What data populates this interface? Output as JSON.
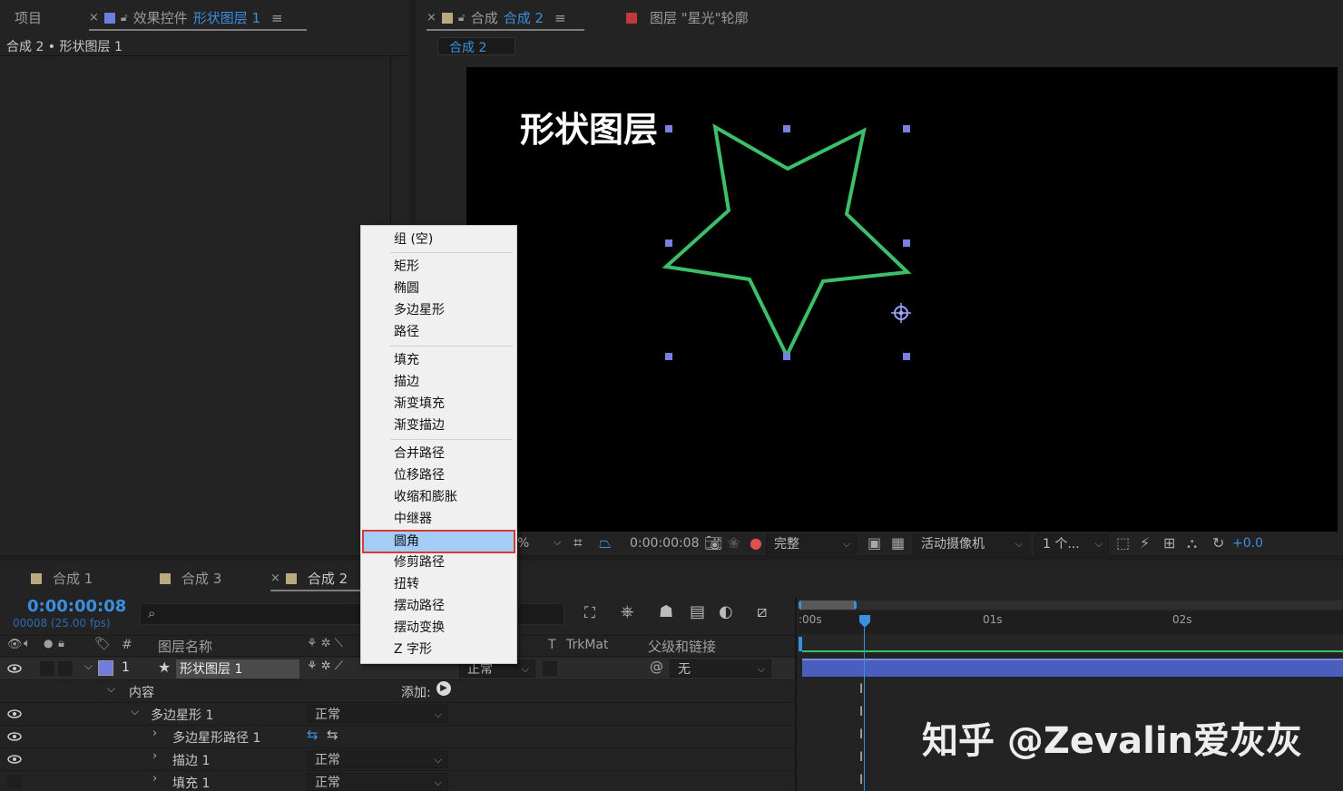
{
  "top_tabs": {
    "project": "项目",
    "effects_label": "效果控件",
    "effects_layer": "形状图层 1",
    "comp_label": "合成",
    "comp_name": "合成 2",
    "layer_panel": "图层 \"星光\"轮廓",
    "close_glyph": "×",
    "menu_glyph": "≡"
  },
  "effects_panel": {
    "breadcrumb": "合成 2 • 形状图层 1"
  },
  "viewer": {
    "comp_tab": "合成 2",
    "canvas_text": "形状图层",
    "toolbar": {
      "zoom_fragment": "%",
      "timecode": "0:00:00:08",
      "resolution": "完整",
      "camera": "活动摄像机",
      "views": "1 个...",
      "exposure": "+0.0"
    }
  },
  "context_menu": {
    "groups": [
      [
        "组 (空)"
      ],
      [
        "矩形",
        "椭圆",
        "多边星形",
        "路径"
      ],
      [
        "填充",
        "描边",
        "渐变填充",
        "渐变描边"
      ],
      [
        "合并路径",
        "位移路径",
        "收缩和膨胀",
        "中继器",
        "圆角",
        "修剪路径",
        "扭转",
        "摆动路径",
        "摆动变换",
        "Z 字形"
      ]
    ],
    "highlighted": "圆角"
  },
  "timeline": {
    "tabs": [
      "合成 1",
      "合成 3",
      "合成 2"
    ],
    "current_time": "0:00:00:08",
    "frame_info": "00008 (25.00 fps)",
    "headers": {
      "num": "#",
      "layer_name": "图层名称",
      "trkmat": "TrkMat",
      "trkmat_t": "T",
      "parent": "父级和链接"
    },
    "ruler": [
      ":00s",
      "01s",
      "02s"
    ],
    "layer": {
      "num": "1",
      "name": "形状图层 1",
      "mode": "正常",
      "parent": "无"
    },
    "contents": {
      "label": "内容",
      "add_label": "添加:"
    },
    "rows": [
      {
        "name": "多边星形 1",
        "mode": "正常"
      },
      {
        "name": "多边星形路径 1"
      },
      {
        "name": "描边 1",
        "mode": "正常"
      },
      {
        "name": "填充 1",
        "mode": "正常"
      }
    ]
  },
  "watermark": "知乎 @Zevalin爱灰灰",
  "colors": {
    "accent_blue": "#3c8fe0",
    "star_stroke": "#3dbf6a",
    "handle": "#7b7fe0",
    "layer_bar": "#4a5fbd",
    "menu_highlight": "#a3cdf7",
    "menu_outline": "#d63a32"
  }
}
